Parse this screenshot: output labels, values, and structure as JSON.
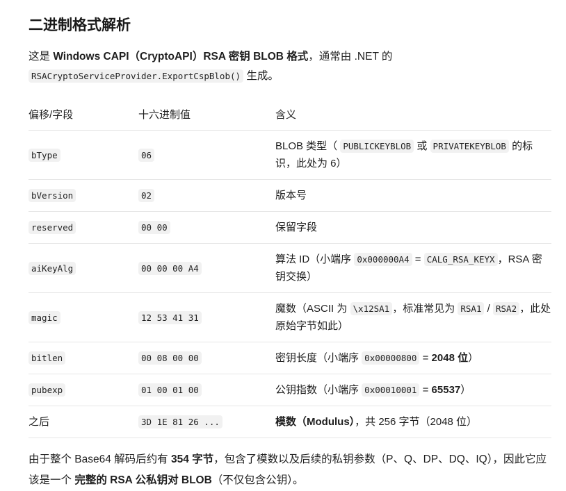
{
  "heading": "二进制格式解析",
  "intro": {
    "t1": "这是 ",
    "b1": "Windows CAPI（CryptoAPI）RSA 密钥 BLOB 格式",
    "t2": "，通常由 .NET 的",
    "code1": "RSACryptoServiceProvider.ExportCspBlob()",
    "t3": " 生成。"
  },
  "table": {
    "headers": [
      "偏移/字段",
      "十六进制值",
      "含义"
    ],
    "rows": {
      "btype": {
        "field": "bType",
        "hex": "06",
        "m1": "BLOB 类型（ ",
        "c1": "PUBLICKEYBLOB",
        "m2": " 或 ",
        "c2": "PRIVATEKEYBLOB",
        "m3": " 的标识，此处为 6）"
      },
      "bversion": {
        "field": "bVersion",
        "hex": "02",
        "m1": "版本号"
      },
      "reserved": {
        "field": "reserved",
        "hex": "00 00",
        "m1": "保留字段"
      },
      "aikeyalg": {
        "field": "aiKeyAlg",
        "hex": "00 00 00 A4",
        "m1": "算法 ID（小端序 ",
        "c1": "0x000000A4",
        "m2": " = ",
        "c2": "CALG_RSA_KEYX",
        "m3": "，RSA 密钥交换）"
      },
      "magic": {
        "field": "magic",
        "hex": "12 53 41 31",
        "m1": "魔数（ASCII 为 ",
        "c1": "\\x12SA1",
        "m2": "，标准常见为 ",
        "c2": "RSA1",
        "m3": " / ",
        "c3": "RSA2",
        "m4": "，此处原始字节如此）"
      },
      "bitlen": {
        "field": "bitlen",
        "hex": "00 08 00 00",
        "m1": "密钥长度（小端序 ",
        "c1": "0x00000800",
        "m2": " = ",
        "b1": "2048 位",
        "m3": "）"
      },
      "pubexp": {
        "field": "pubexp",
        "hex": "01 00 01 00",
        "m1": "公钥指数（小端序 ",
        "c1": "0x00010001",
        "m2": " = ",
        "b1": "65537",
        "m3": "）"
      },
      "after": {
        "field": "之后",
        "hex": "3D 1E 81 26 ...",
        "b1": "模数（Modulus）",
        "m1": "，共 256 字节（2048 位）"
      }
    }
  },
  "outro": {
    "t1": "由于整个 Base64 解码后约有 ",
    "b1": "354 字节",
    "t2": "，包含了模数以及后续的私钥参数（P、Q、DP、DQ、IQ），因此它应该是一个 ",
    "b2": "完整的 RSA 公私钥对 BLOB",
    "t3": "（不仅包含公钥）。"
  }
}
